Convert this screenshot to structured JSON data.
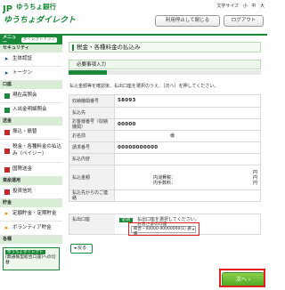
{
  "header": {
    "logo_text": "ゆうちょ銀行",
    "brand_sub": "ゆうちょダイレクト",
    "fontsize_label": "文字サイズ",
    "fontsize_options": [
      "小",
      "中",
      "大"
    ],
    "stop_button": "利用停止して閉じる",
    "logout_button": "ログアウト",
    "accent_color": "#1a8a3a"
  },
  "sidebar": {
    "menu_label": "メニュー",
    "direct_top": "ダイレクトトップ",
    "security_heading": "セキュリティ",
    "auth_items": [
      {
        "label": "生体認証"
      },
      {
        "label": "トークン"
      }
    ],
    "account_heading": "口座",
    "account_items": [
      {
        "label": "現在高照会"
      },
      {
        "label": "入出金明細照会"
      }
    ],
    "transfer_heading": "送金",
    "transfer_items": [
      {
        "label": "振込・振替"
      },
      {
        "label": "税金・各種料金の払込み（ペイジー）"
      },
      {
        "label": "国際送金"
      }
    ],
    "invest_heading": "資産運用",
    "invest_items": [
      {
        "label": "投資信託"
      }
    ],
    "savings_heading": "貯金",
    "savings_items": [
      {
        "label": "定額貯金・定期貯金"
      },
      {
        "label": "ボランティア貯金"
      }
    ],
    "settings_heading": "各種",
    "promo_tag": "ゆうちょダイレクト",
    "promo_text": "(無通帳型総合口座)への切替"
  },
  "main": {
    "title": "税金・各種料金の払込み",
    "step_label": "必要事項入力",
    "progress_percent": 20,
    "instruction": "払込金額等を確認後、払出口座を選択のうえ、［次へ］を押してください。",
    "rows": [
      {
        "label": "収納機関番号",
        "value": "58093"
      },
      {
        "label": "払込先",
        "value": ""
      },
      {
        "label": "お客様番号（収納機関）",
        "value": "00000"
      },
      {
        "label": "お名前",
        "value": "様"
      },
      {
        "label": "請求番号",
        "value": "00000000000"
      },
      {
        "label": "払込内容",
        "value": ""
      },
      {
        "label": "払込金額",
        "value": "円"
      },
      {
        "label": "払込先からのご連絡",
        "value": ""
      }
    ],
    "fee": {
      "label1": "内消費税：",
      "unit1": "円",
      "label2": "内手数料：",
      "unit2": "円"
    },
    "pay_account": {
      "label": "払出口座",
      "required": "必須",
      "instruction": "払出口座を選択してください。",
      "sub": "お客さまの口座",
      "select_value": "総合・00000-00000000(1) 通帳"
    },
    "back_button": "戻る",
    "next_button": "次へ"
  }
}
